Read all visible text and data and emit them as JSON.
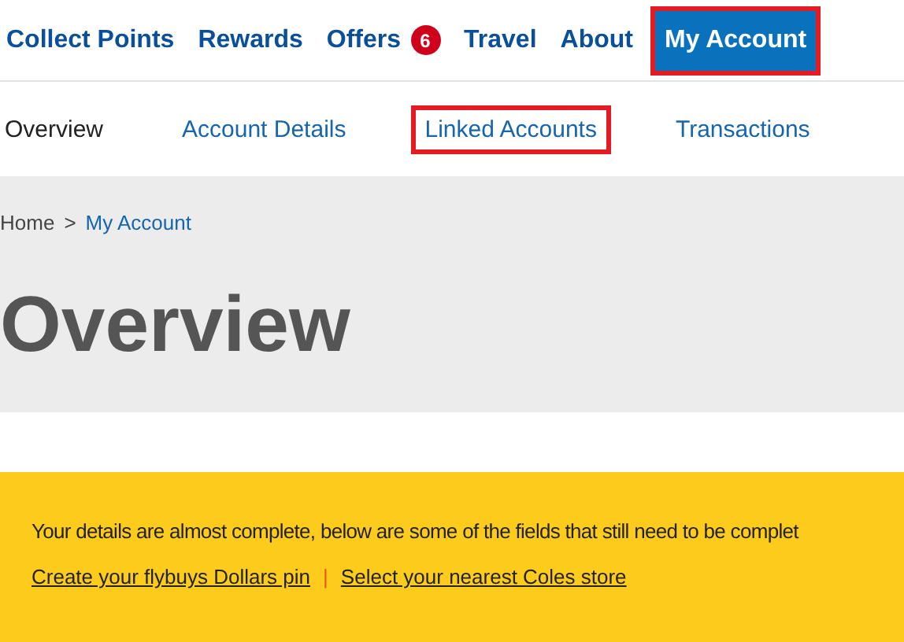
{
  "main_nav": [
    {
      "label": "Collect Points",
      "selected": false,
      "highlighted": false
    },
    {
      "label": "Rewards",
      "selected": false,
      "highlighted": false
    },
    {
      "label": "Offers",
      "badge": "6",
      "selected": false,
      "highlighted": false
    },
    {
      "label": "Travel",
      "selected": false,
      "highlighted": false
    },
    {
      "label": "About",
      "selected": false,
      "highlighted": false
    },
    {
      "label": "My Account",
      "selected": true,
      "highlighted": true
    }
  ],
  "sub_nav": [
    {
      "label": "Overview",
      "selected": true,
      "highlighted": false
    },
    {
      "label": "Account Details",
      "selected": false,
      "highlighted": false
    },
    {
      "label": "Linked Accounts",
      "selected": false,
      "highlighted": true
    },
    {
      "label": "Transactions",
      "selected": false,
      "highlighted": false
    }
  ],
  "breadcrumb": {
    "items": [
      "Home",
      "My Account"
    ],
    "separator": ">"
  },
  "page_title": "Overview",
  "notice": {
    "message": "Your details are almost complete, below are some of the fields that still need to be complet",
    "links": [
      "Create your flybuys Dollars pin",
      "Select your nearest Coles store"
    ],
    "separator": "|"
  }
}
